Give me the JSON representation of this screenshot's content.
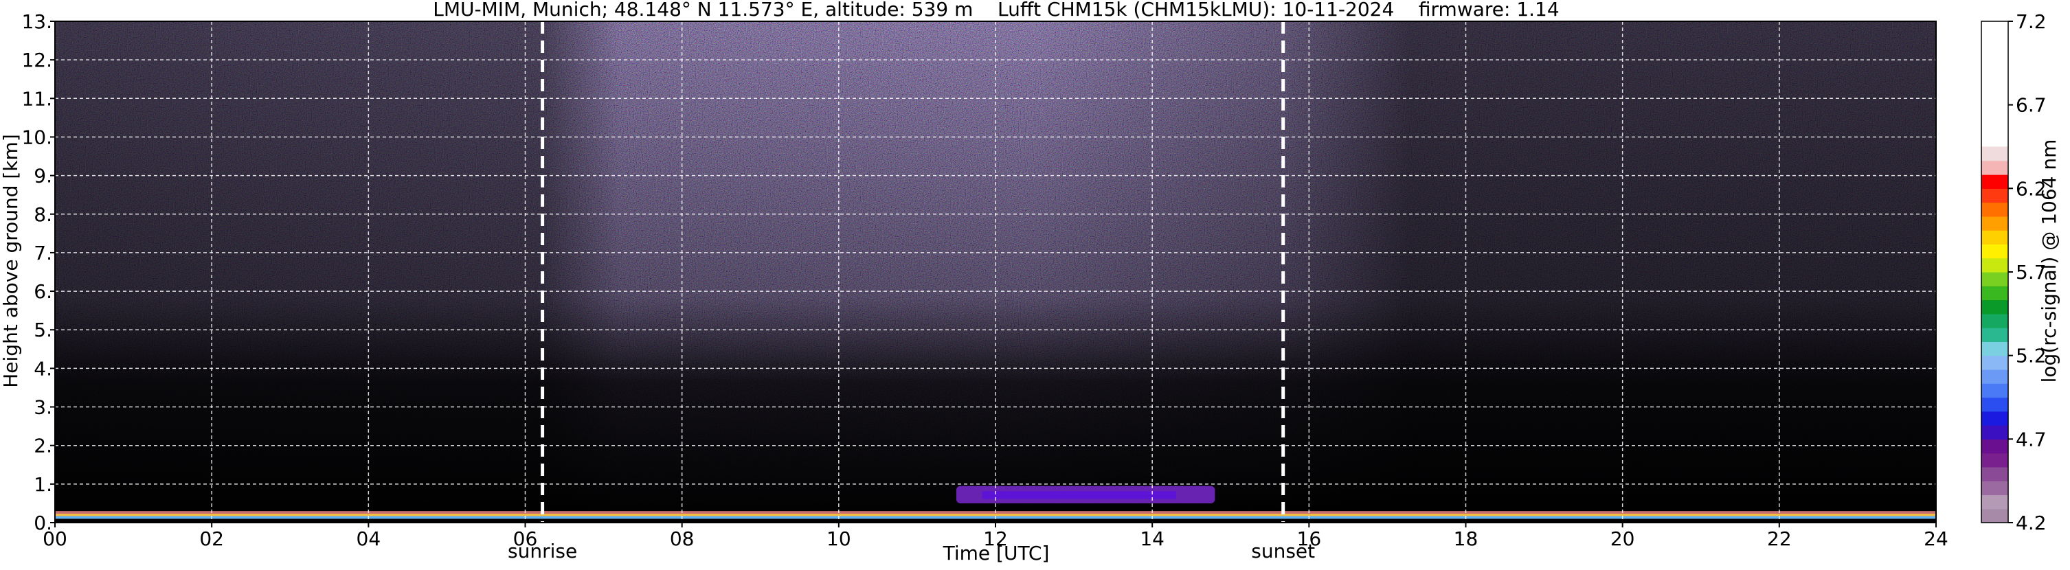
{
  "chart_data": {
    "type": "heatmap",
    "title": "LMU-MIM, Munich; 48.148° N 11.573° E, altitude: 539 m    Lufft CHM15k (CHM15kLMU): 10-11-2024    firmware: 1.14",
    "xlabel": "Time [UTC]",
    "ylabel": "Height above ground [km]",
    "xlim": [
      0,
      24
    ],
    "ylim": [
      0,
      13
    ],
    "x_ticks": [
      "00",
      "02",
      "04",
      "06",
      "08",
      "10",
      "12",
      "14",
      "16",
      "18",
      "20",
      "22",
      "24"
    ],
    "y_ticks": [
      "0.",
      "1.",
      "2.",
      "3.",
      "4.",
      "5.",
      "6.",
      "7.",
      "8.",
      "9.",
      "10.",
      "11.",
      "12.",
      "13."
    ],
    "grid": true,
    "annotations": [
      {
        "label": "sunrise",
        "x": 6.22
      },
      {
        "label": "sunset",
        "x": 15.67
      }
    ],
    "colorbar": {
      "label": "log(rc-signal) @ 1064 nm",
      "range": [
        4.2,
        7.2
      ],
      "ticks": [
        "4.2",
        "4.7",
        "5.2",
        "5.7",
        "6.2",
        "6.7",
        "7.2"
      ],
      "colors": [
        "#a78aa8",
        "#b59ab6",
        "#9a6aa0",
        "#8a4a96",
        "#7a1f8e",
        "#6a0f90",
        "#3a10c0",
        "#1a1ae0",
        "#2a4ef0",
        "#4a7af6",
        "#6a9af6",
        "#8ab8f6",
        "#7ad0e0",
        "#2ab890",
        "#14a860",
        "#0a9a2a",
        "#3ab820",
        "#7ad020",
        "#c8e810",
        "#fff000",
        "#ffd000",
        "#ffa000",
        "#ff7000",
        "#ff3a10",
        "#ff0000",
        "#f5b5b5",
        "#f0dcdc",
        "#ffffff"
      ]
    },
    "features": [
      {
        "name": "aerosol boundary layer",
        "x": [
          0,
          24
        ],
        "height_km": [
          0.1,
          0.3
        ]
      },
      {
        "name": "cloud layer",
        "x": [
          11.5,
          14.8
        ],
        "height_km": [
          0.5,
          0.95
        ]
      }
    ]
  }
}
